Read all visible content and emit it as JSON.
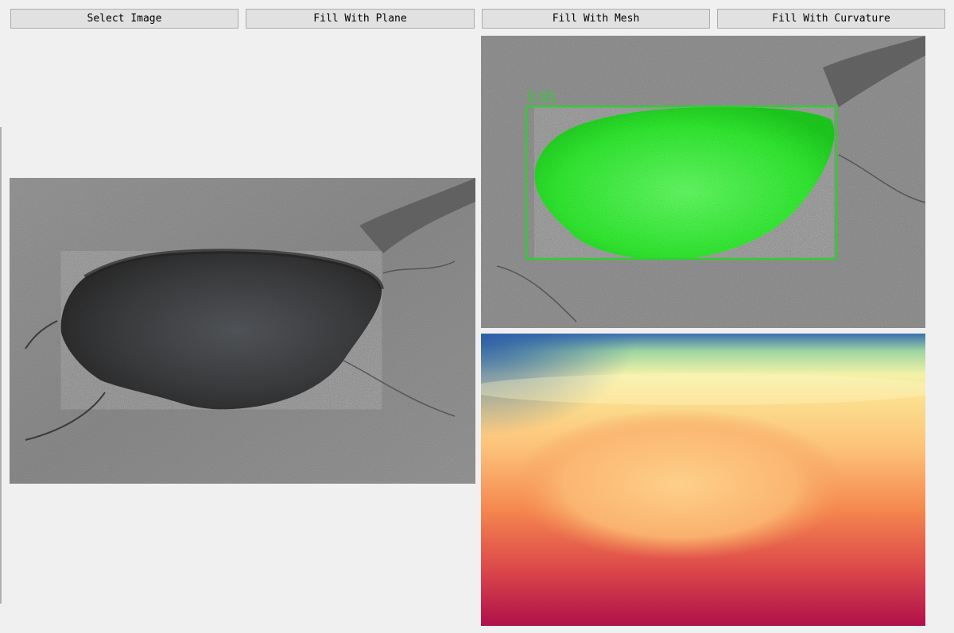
{
  "toolbar": {
    "select_image_label": "Select Image",
    "fill_plane_label": "Fill With Plane",
    "fill_mesh_label": "Fill With Mesh",
    "fill_curvature_label": "Fill With Curvature"
  },
  "detection": {
    "confidence_label": "0.91",
    "box_color": "#33cc33",
    "mask_color": "#22ff22"
  },
  "colors": {
    "window_bg": "#f0f0f0",
    "button_bg": "#e1e1e1",
    "button_border": "#adadad",
    "asphalt": "#8d8d8d",
    "pothole": "#3c3c3c"
  }
}
